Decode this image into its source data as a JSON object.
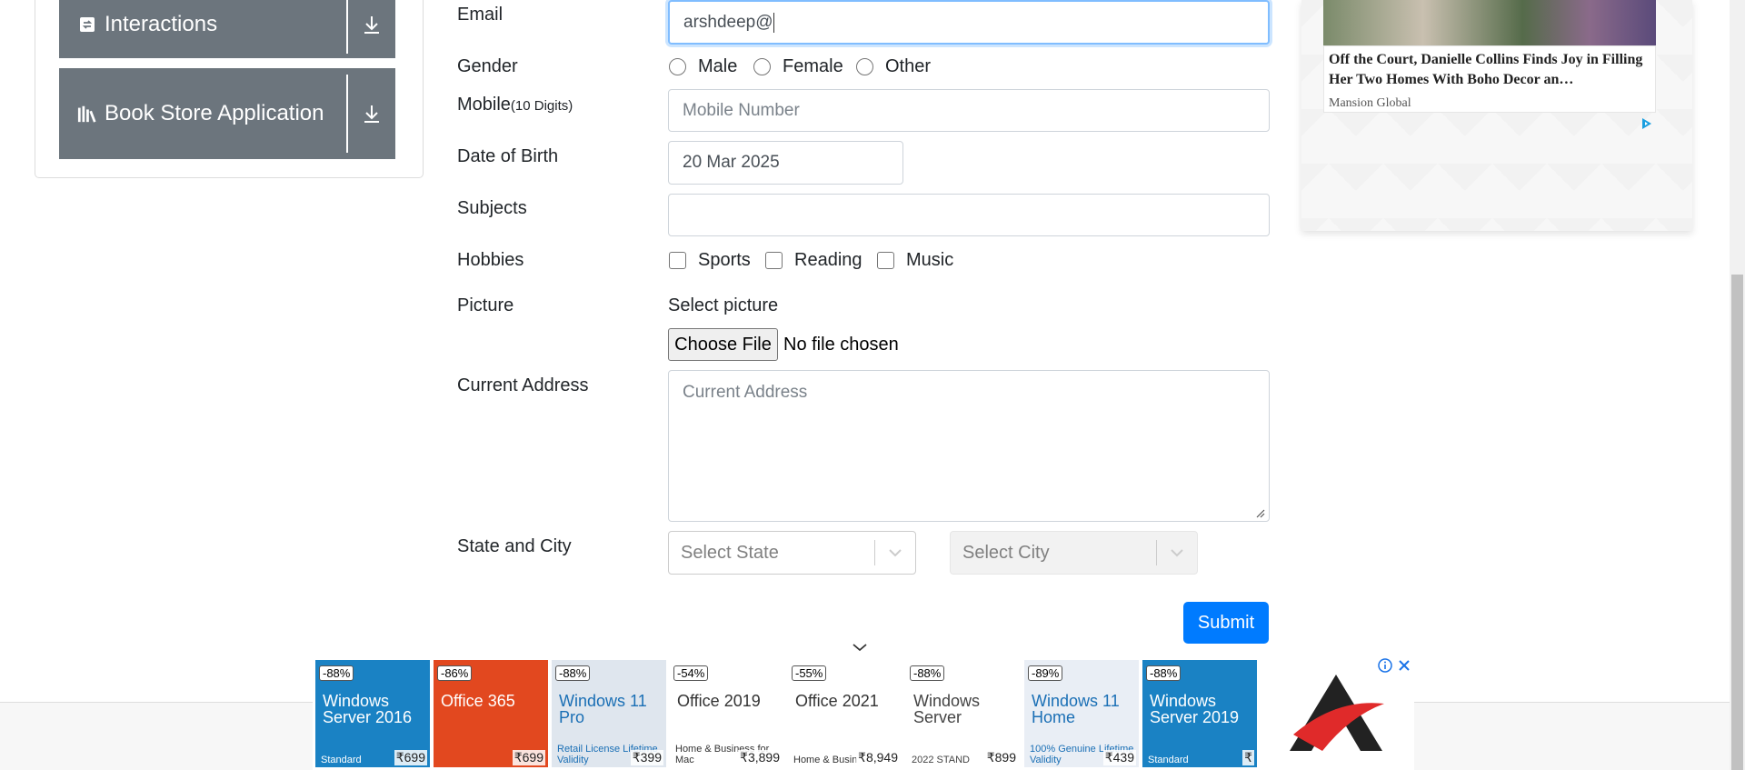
{
  "sidebar": {
    "items": [
      {
        "label": "Interactions",
        "icon": "interactions-icon"
      },
      {
        "label": "Book Store Application",
        "icon": "books-icon"
      }
    ]
  },
  "form": {
    "email": {
      "label": "Email",
      "value": "arshdeep@"
    },
    "gender": {
      "label": "Gender",
      "options": [
        "Male",
        "Female",
        "Other"
      ]
    },
    "mobile": {
      "label": "Mobile",
      "hint": "(10 Digits)",
      "placeholder": "Mobile Number"
    },
    "dob": {
      "label": "Date of Birth",
      "value": "20 Mar 2025"
    },
    "subjects": {
      "label": "Subjects",
      "value": ""
    },
    "hobbies": {
      "label": "Hobbies",
      "options": [
        "Sports",
        "Reading",
        "Music"
      ]
    },
    "picture": {
      "label": "Picture",
      "select_label": "Select picture",
      "button": "Choose File",
      "status": "No file chosen"
    },
    "address": {
      "label": "Current Address",
      "placeholder": "Current Address"
    },
    "state_city": {
      "label": "State and City",
      "state_placeholder": "Select State",
      "city_placeholder": "Select City"
    },
    "submit": "Submit"
  },
  "right_ad": {
    "title": "Off the Court, Danielle Collins Finds Joy in Filling Her Two Homes With Boho Decor an…",
    "source": "Mansion Global"
  },
  "bottom_ads": [
    {
      "discount": "-88%",
      "product": "Windows Server 2016",
      "foot": "Standard",
      "price": "₹699",
      "bg": "#1a82c4",
      "fg": "#ffffff"
    },
    {
      "discount": "-86%",
      "product": "Office 365",
      "foot": "",
      "price": "₹699",
      "bg": "#e2481f",
      "fg": "#ffffff"
    },
    {
      "discount": "-88%",
      "product": "Windows 11 Pro",
      "foot": "Retail License Lifetime Validity",
      "price": "₹399",
      "bg": "#dfe6ee",
      "fg": "#1a6fb5"
    },
    {
      "discount": "-54%",
      "product": "Office 2019",
      "foot": "Home & Business for Mac",
      "price": "₹3,899",
      "bg": "#ffffff",
      "fg": "#333333"
    },
    {
      "discount": "-55%",
      "product": "Office 2021",
      "foot": "Home & Busin",
      "price": "₹8,949",
      "bg": "#ffffff",
      "fg": "#333333"
    },
    {
      "discount": "-88%",
      "product": "Windows Server",
      "foot": "2022 STAND",
      "price": "₹899",
      "bg": "#ffffff",
      "fg": "#444444"
    },
    {
      "discount": "-89%",
      "product": "Windows 11 Home",
      "foot": "100% Genuine Lifetime Validity",
      "price": "₹439",
      "bg": "#e9eef5",
      "fg": "#1a6fb5"
    },
    {
      "discount": "-88%",
      "product": "Windows Server 2019",
      "foot": "Standard",
      "price": "₹",
      "bg": "#1a82c4",
      "fg": "#ffffff"
    }
  ],
  "colors": {
    "primary": "#007bff",
    "sidebar": "#6c757d",
    "focus": "#80bdff"
  }
}
